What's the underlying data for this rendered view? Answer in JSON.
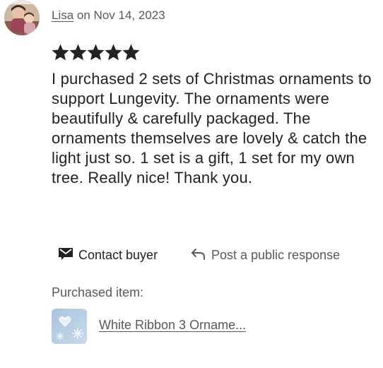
{
  "review": {
    "reviewer_name": "Lisa",
    "date_text": "on Nov 14, 2023",
    "rating": 5,
    "rating_max": 5,
    "text": "I purchased 2 sets of Christmas ornaments to support Lungevity. The ornaments were beautifully & carefully packaged. The ornaments themselves are lovely & catch the light just so. 1 set is a gift, 1 set for my own tree. Really nice! Thank you."
  },
  "actions": {
    "contact_buyer_label": "Contact buyer",
    "contact_buyer_icon": "envelope-icon",
    "post_response_label": "Post a public response",
    "post_response_icon": "reply-arrow-icon"
  },
  "purchased": {
    "label": "Purchased item:",
    "item_title": "White Ribbon 3 Orname...",
    "thumbnail_icon": "ornament-thumbnail"
  },
  "colors": {
    "primary_text": "#222222",
    "secondary_text": "#595959",
    "star": "#222222"
  }
}
